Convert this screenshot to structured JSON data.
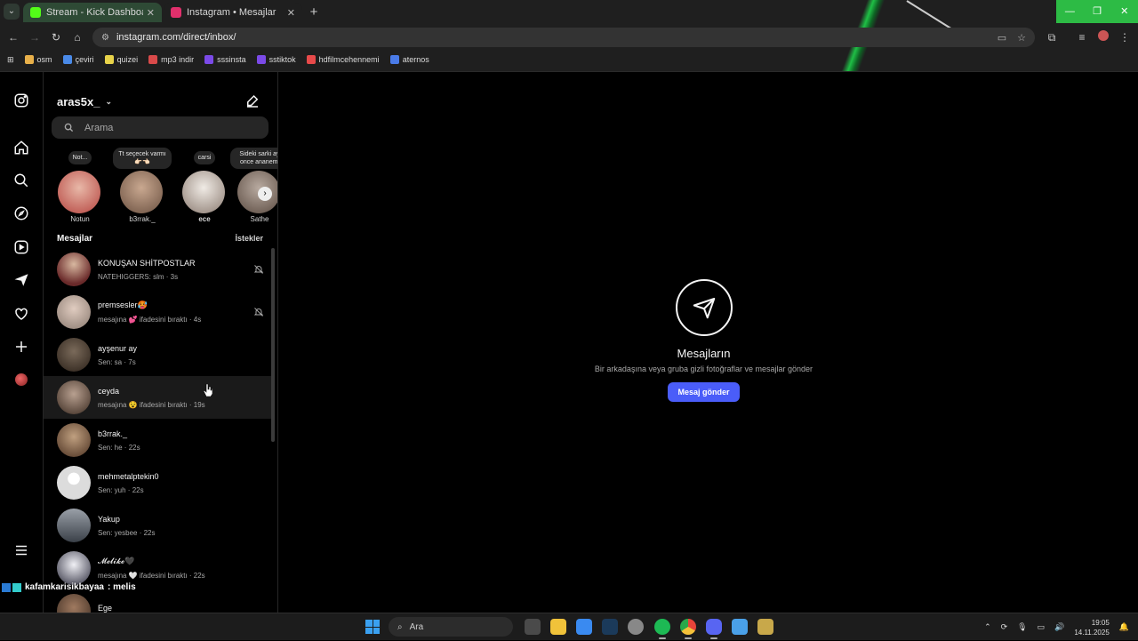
{
  "browser": {
    "tabs": [
      {
        "title": "Stream - Kick Dashboard",
        "active": true,
        "favicon_color": "#53fc18"
      },
      {
        "title": "Instagram • Mesajlar",
        "active": false,
        "favicon_color": "#e1306c"
      }
    ],
    "url": "instagram.com/direct/inbox/",
    "bookmarks": [
      {
        "label": "osm",
        "color": "#e8b04a"
      },
      {
        "label": "çeviri",
        "color": "#4a8ae8"
      },
      {
        "label": "quizei",
        "color": "#e8d34a"
      },
      {
        "label": "mp3 indir",
        "color": "#d94a4a"
      },
      {
        "label": "sssinsta",
        "color": "#7b4ae8"
      },
      {
        "label": "sstiktok",
        "color": "#7b4ae8"
      },
      {
        "label": "hdfilmcehennemi",
        "color": "#e84a4a"
      },
      {
        "label": "aternos",
        "color": "#4a7be8"
      }
    ]
  },
  "inbox": {
    "username": "aras5x_",
    "search_placeholder": "Arama",
    "notes": [
      {
        "bubble": "Not...",
        "name": "Notun",
        "avatar": "#b5443f",
        "bold": false
      },
      {
        "bubble": "Tt seçecek varmı 👉🏻👈🏻",
        "name": "b3rrak._",
        "avatar": "#6a5040",
        "bold": false
      },
      {
        "bubble": "carsi",
        "name": "ece",
        "avatar": "#cfc6bd",
        "bold": true
      },
      {
        "bubble": "Sideki sarki ay once ananemi",
        "name": "Sathe",
        "avatar": "#8a7a70",
        "bold": false
      }
    ],
    "messages_label": "Mesajlar",
    "requests_label": "İstekler",
    "threads": [
      {
        "name": "KONUŞAN SHİTPOSTLAR",
        "snippet": "NATEHIGGERS: slm · 3s",
        "avatar": "#8a6a5a",
        "muted": true,
        "active": false
      },
      {
        "name": "premsesler🥵",
        "snippet": "mesajına 💕 ifadesini bıraktı · 4s",
        "avatar": "#b9a59a",
        "muted": true,
        "active": false
      },
      {
        "name": "ayşenur ay",
        "snippet": "Sen: sa · 7s",
        "avatar": "#4a3a2a",
        "muted": false,
        "active": false
      },
      {
        "name": "ceyda",
        "snippet": "mesajına 😵 ifadesini bıraktı · 19s",
        "avatar": "#6a5a50",
        "muted": false,
        "active": true
      },
      {
        "name": "b3rrak._",
        "snippet": "Sen: he · 22s",
        "avatar": "#7a6050",
        "muted": false,
        "active": false
      },
      {
        "name": "mehmetalptekin0",
        "snippet": "Sen: yuh · 22s",
        "avatar": "#dcdcdc",
        "muted": false,
        "active": false
      },
      {
        "name": "Yakup",
        "snippet": "Sen: yesbee · 22s",
        "avatar": "#5a6068",
        "muted": false,
        "active": false
      },
      {
        "name": "𝓜𝓮𝓵𝓲𝓴𝓮🖤",
        "snippet": "mesajına 🤍 ifadesini bıraktı · 22s",
        "avatar": "#d8d8e0",
        "muted": false,
        "active": false
      },
      {
        "name": "Ege",
        "snippet": "",
        "avatar": "#6a4a3a",
        "muted": false,
        "active": false
      }
    ]
  },
  "empty_state": {
    "title": "Mesajların",
    "subtitle": "Bir arkadaşına veya gruba gizli fotoğraflar ve mesajlar gönder",
    "button": "Mesaj gönder"
  },
  "overlay_chat": {
    "user": "kafamkarisikbayaa",
    "message": ": melis"
  },
  "taskbar": {
    "search": "Ara",
    "time": "19:05",
    "date": "14.11.2025",
    "apps": [
      {
        "name": "task-view",
        "color": "#4a4a4a"
      },
      {
        "name": "file-explorer",
        "color": "#f0c23a"
      },
      {
        "name": "store",
        "color": "#3a8af0"
      },
      {
        "name": "steam",
        "color": "#1b3a5a"
      },
      {
        "name": "app-github",
        "color": "#888"
      },
      {
        "name": "spotify",
        "color": "#1db954"
      },
      {
        "name": "chrome",
        "color": "#e8443a"
      },
      {
        "name": "discord",
        "color": "#5865f2"
      },
      {
        "name": "app-blue",
        "color": "#4aa0e8"
      },
      {
        "name": "league",
        "color": "#c8a84a"
      }
    ]
  },
  "colors": {
    "accent": "#4a5df9",
    "window_controls": "#2dbb45"
  }
}
